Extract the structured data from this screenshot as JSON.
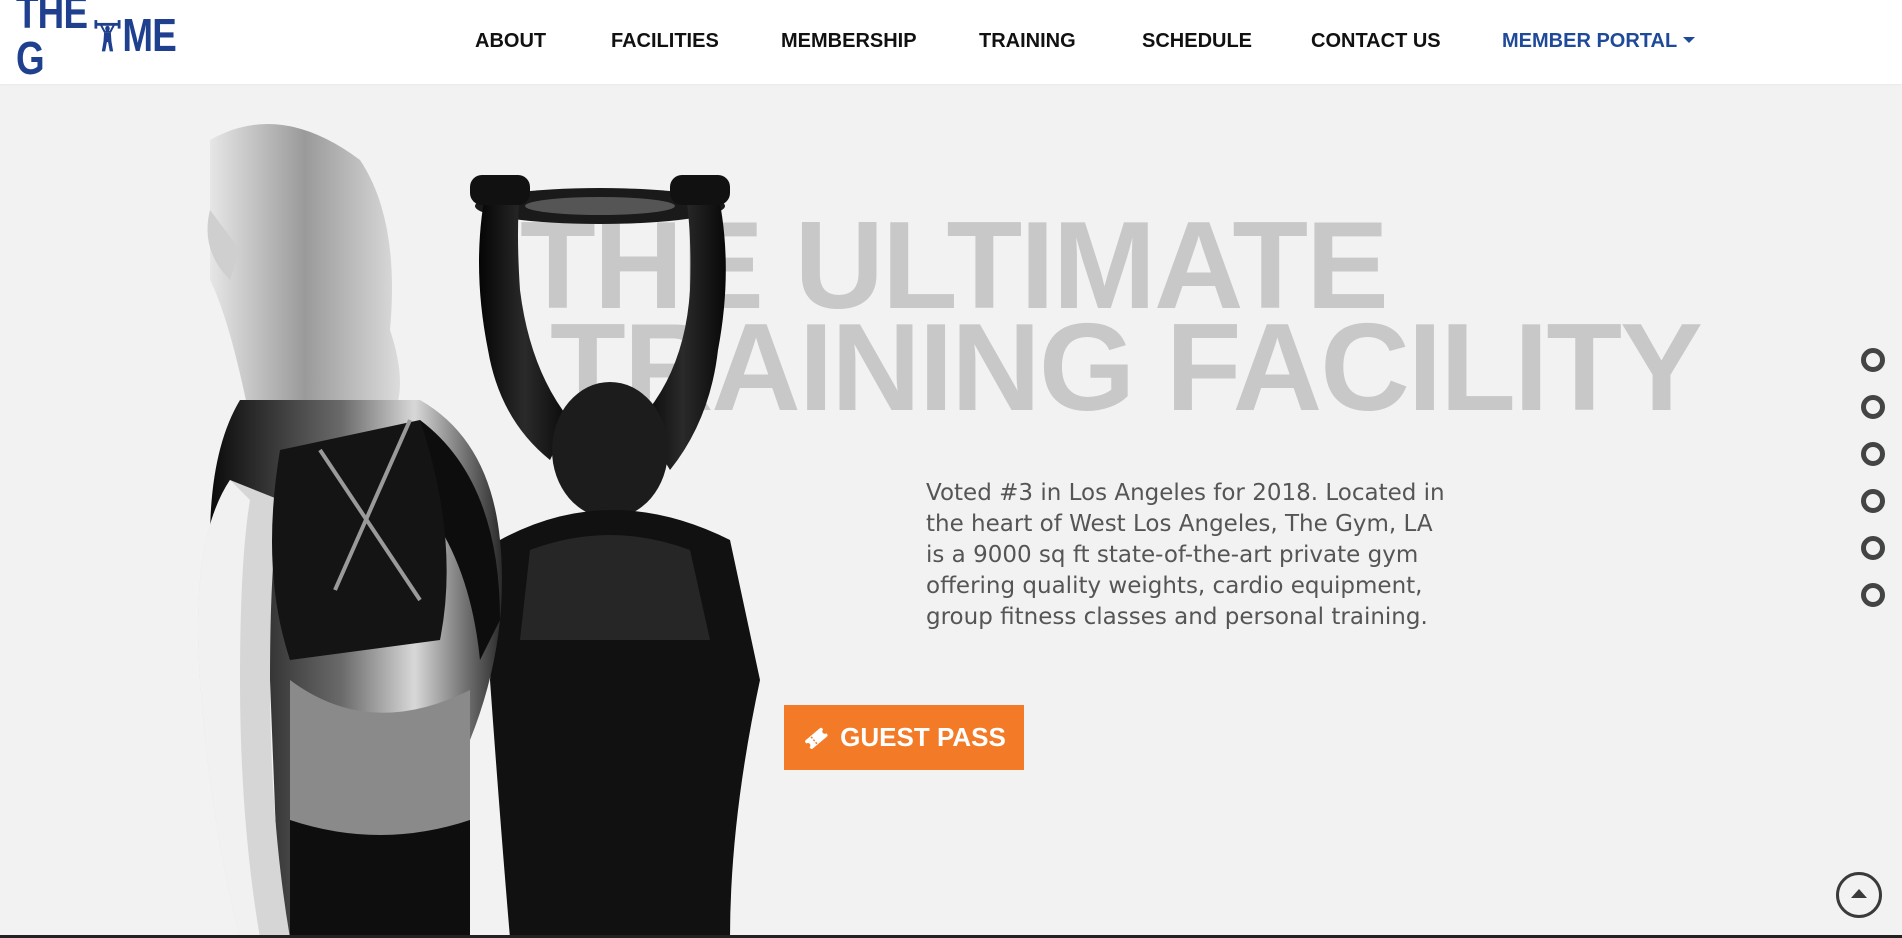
{
  "header": {
    "logo_text_left": "THE G",
    "logo_text_right": "ME",
    "nav": [
      {
        "label": "ABOUT"
      },
      {
        "label": "FACILITIES"
      },
      {
        "label": "MEMBERSHIP"
      },
      {
        "label": "TRAINING"
      },
      {
        "label": "SCHEDULE"
      },
      {
        "label": "CONTACT US"
      },
      {
        "label": "MEMBER PORTAL"
      }
    ]
  },
  "hero": {
    "title_line1": "THE ULTIMATE",
    "title_line2": "TRAINING FACILITY",
    "description": "Voted #3 in Los Angeles for 2018. Located in the heart of West Los Angeles, The Gym, LA is a 9000 sq ft state-of-the-art private gym offering quality weights, cardio equipment, group fitness classes and personal training.",
    "button_label": "GUEST PASS",
    "button_icon": "ticket-icon"
  },
  "section_nav": {
    "dot_count": 6
  },
  "colors": {
    "brand_blue": "#1f3f8f",
    "accent_orange": "#f37a26",
    "title_gray": "#c8c8c8",
    "background": "#f2f2f2"
  }
}
